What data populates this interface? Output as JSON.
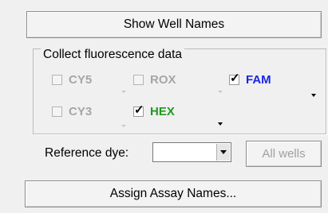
{
  "buttons": {
    "show_well_names": "Show Well Names",
    "assign_assay_names": "Assign Assay Names...",
    "all_wells": "All wells"
  },
  "group": {
    "title": "Collect fluorescence data",
    "dyes": [
      {
        "label": "CY5",
        "checked": false,
        "enabled": false,
        "color": "#a6a6a6"
      },
      {
        "label": "ROX",
        "checked": false,
        "enabled": false,
        "color": "#a6a6a6"
      },
      {
        "label": "FAM",
        "checked": true,
        "enabled": true,
        "color": "#1c24e6"
      },
      {
        "label": "CY3",
        "checked": false,
        "enabled": false,
        "color": "#a6a6a6"
      },
      {
        "label": "HEX",
        "checked": true,
        "enabled": true,
        "color": "#1e9a1e"
      }
    ]
  },
  "reference": {
    "label": "Reference dye:",
    "value": ""
  },
  "icons": {
    "check": "checkmark-icon",
    "dropdown": "chevron-down-icon"
  }
}
